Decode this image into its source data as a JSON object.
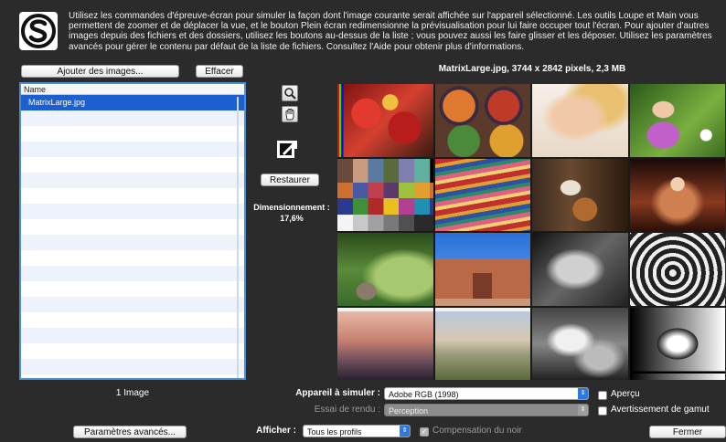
{
  "intro_text": "Utilisez les commandes d'épreuve-écran pour simuler la façon dont l'image courante serait affichée sur l'appareil sélectionné. Les outils Loupe et Main vous permettent de zoomer et de déplacer la vue, et le bouton Plein écran redimensionne la prévisualisation pour lui faire occuper tout l'écran. Pour ajouter d'autres images depuis des fichiers et des dossiers, utilisez les boutons au-dessus de la liste ; vous pouvez aussi les faire glisser et les déposer. Utilisez les paramètres avancés pour gérer le contenu par défaut de la liste de fichiers. Consultez l'Aide pour obtenir plus d'informations.",
  "buttons": {
    "add_images": "Ajouter des images...",
    "clear": "Effacer",
    "restore": "Restaurer",
    "advanced": "Paramètres avancés...",
    "close": "Fermer"
  },
  "file_list": {
    "column_header": "Name",
    "files": [
      "MatrixLarge.jpg"
    ],
    "count_text": "1 Image"
  },
  "image_info": "MatrixLarge.jpg, 3744 x 2842 pixels, 2,3 MB",
  "tools": {
    "zoom": "magnifier-icon",
    "hand": "hand-icon",
    "fullscreen": "fullscreen-arrow-icon"
  },
  "scaling": {
    "label": "Dimensionnement :",
    "value": "17,6%"
  },
  "controls": {
    "device_label": "Appareil à simuler :",
    "device_value": "Adobe RGB (1998)",
    "proof_label": "Essai de rendu :",
    "proof_value": "Perception",
    "show_label": "Afficher :",
    "show_value": "Tous les profils",
    "preview_label": "Aperçu",
    "preview_checked": false,
    "gamut_label": "Avertissement de gamut",
    "gamut_checked": false,
    "black_comp_label": "Compensation du noir",
    "black_comp_checked": true
  },
  "colors": {
    "background": "#2b2b2b",
    "selection": "#1b5fd1",
    "list_border": "#4a8fd6",
    "popup_arrow": "#2e78e6"
  }
}
